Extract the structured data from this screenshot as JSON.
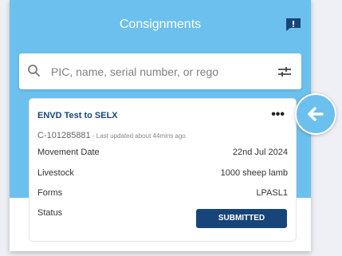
{
  "header": {
    "title": "Consignments"
  },
  "search": {
    "placeholder": "PIC, name, serial number, or rego"
  },
  "card": {
    "title": "ENVD Test to SELX",
    "more": "•••",
    "id": "C-101285881",
    "updated": " - Last updated about 44mins ago",
    "rows": [
      {
        "label": "Movement Date",
        "value": "22nd Jul 2024"
      },
      {
        "label": "Livestock",
        "value": "1000 sheep lamb"
      },
      {
        "label": "Forms",
        "value": "LPASL1"
      },
      {
        "label": "Status",
        "value": ""
      }
    ],
    "status": "SUBMITTED"
  },
  "colors": {
    "primary": "#6cc0ee",
    "navy": "#17457a"
  },
  "icons": {
    "chat": "chat-alert-icon",
    "search": "search-icon",
    "filter": "filter-icon",
    "back": "arrow-left-icon"
  }
}
